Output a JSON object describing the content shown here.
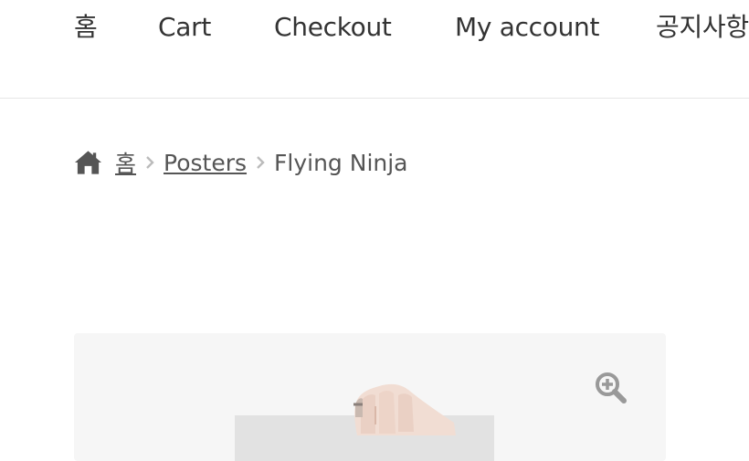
{
  "nav": {
    "items": [
      "홈",
      "Cart",
      "Checkout",
      "My account",
      "공지사항"
    ]
  },
  "breadcrumb": {
    "home_icon": "home-icon",
    "items": [
      "홈",
      "Posters"
    ],
    "current": "Flying Ninja"
  },
  "gallery": {
    "zoom_icon": "zoom-in-icon"
  }
}
